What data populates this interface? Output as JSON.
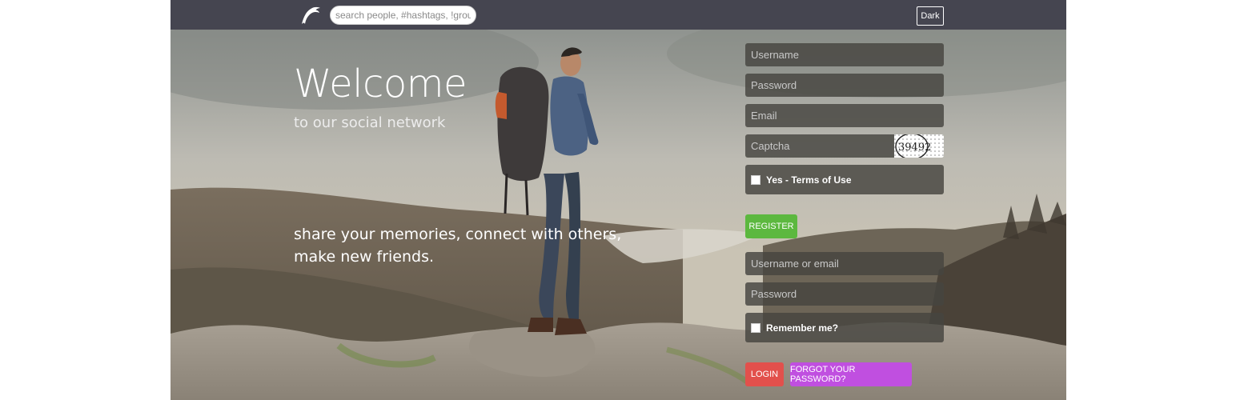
{
  "header": {
    "logo_icon": "dolphin-logo-icon",
    "search": {
      "placeholder": "search people, #hashtags, !groups",
      "value": ""
    },
    "theme_toggle_label": "Dark"
  },
  "hero": {
    "title": "Welcome",
    "subtitle": "to our social network",
    "tagline_line1": "share your memories, connect with others,",
    "tagline_line2": "make new friends."
  },
  "register_form": {
    "username_placeholder": "Username",
    "password_placeholder": "Password",
    "email_placeholder": "Email",
    "captcha_placeholder": "Captcha",
    "captcha_code": "39492",
    "terms_label": "Yes - Terms of Use",
    "register_button": "REGISTER"
  },
  "login_form": {
    "username_placeholder": "Username or email",
    "password_placeholder": "Password",
    "remember_label": "Remember me?",
    "login_button": "LOGIN",
    "forgot_button": "FORGOT YOUR PASSWORD?"
  },
  "colors": {
    "topbar": "#454550",
    "register_button": "#5cb83f",
    "login_button": "#e2504c",
    "forgot_button": "#c04fe0",
    "field_background": "rgba(70,68,64,0.82)"
  }
}
